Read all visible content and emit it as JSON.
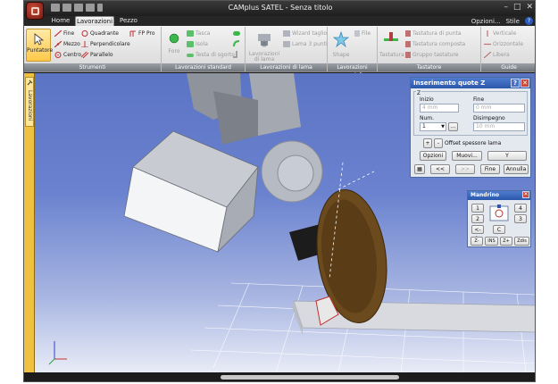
{
  "window": {
    "title": "CAMplus SATEL - Senza titolo",
    "controls": [
      "–",
      "□",
      "✕"
    ]
  },
  "tabs": [
    {
      "label": "Home"
    },
    {
      "label": "Lavorazioni",
      "active": true
    },
    {
      "label": "Pezzo"
    }
  ],
  "tab_right": {
    "options": "Opzioni...",
    "style": "Stile",
    "help": "?"
  },
  "ribbon": {
    "groups": [
      {
        "label": "Strumenti"
      },
      {
        "label": "Lavorazioni standard"
      },
      {
        "label": "Lavorazioni di lama"
      },
      {
        "label": "Lavorazioni speciali"
      },
      {
        "label": "Tastatore"
      },
      {
        "label": "Guide"
      }
    ],
    "strumenti": {
      "pointer": "Puntatore",
      "items": [
        "Fine",
        "Quadrante",
        "FP Pro",
        "Mezzo",
        "Perpendicolare",
        "Centro",
        "Parallelo"
      ]
    },
    "standard": {
      "foro": "Foro",
      "items": [
        "Tasca",
        "Isola",
        "Testa di sgorto"
      ]
    },
    "lama": {
      "big": "Lavorazioni di lama",
      "items": [
        "Wizard taglio",
        "Lama 3 punti"
      ]
    },
    "speciali": {
      "big": "Shape",
      "items": [
        "File"
      ]
    },
    "tastatore": {
      "big": "Tastatura",
      "items": [
        "Tastatura di punta",
        "Tastatura composta",
        "Gruppo tastature"
      ]
    },
    "guide": {
      "items": [
        "Verticale",
        "Orizzontale",
        "Libera"
      ]
    }
  },
  "side_tab": {
    "label": "Lavorazioni"
  },
  "dialog_z": {
    "title": "Inserimento quote Z",
    "section": "Z",
    "inizio_label": "Inizio",
    "inizio_value": "4 mm",
    "fine_label": "Fine",
    "fine_value": "0 mm",
    "num_label": "Num.",
    "num_value": "1",
    "browse": "...",
    "disimpegno_label": "Disimpegno",
    "disimpegno_value": "10 mm",
    "plus": "+",
    "minus": "-",
    "offset_label": "Offset spessore lama",
    "buttons": [
      "Opzioni",
      "Muovi...",
      "Y"
    ],
    "nav": [
      "<<",
      ">>",
      "Fine",
      "Annulla"
    ]
  },
  "dialog_mandrino": {
    "title": "Mandrino",
    "buttons": [
      "1",
      "4",
      "2",
      "3",
      "<->",
      "C",
      "Z-",
      "INS",
      "Z+",
      "Zdis"
    ]
  },
  "colors": {
    "accent": "#2b57aa",
    "viewport_top": "#5b74c4",
    "viewport_bottom": "#e8ecf7",
    "blade": "#6b4a1e",
    "pointer_highlight": "#ffc94a"
  }
}
